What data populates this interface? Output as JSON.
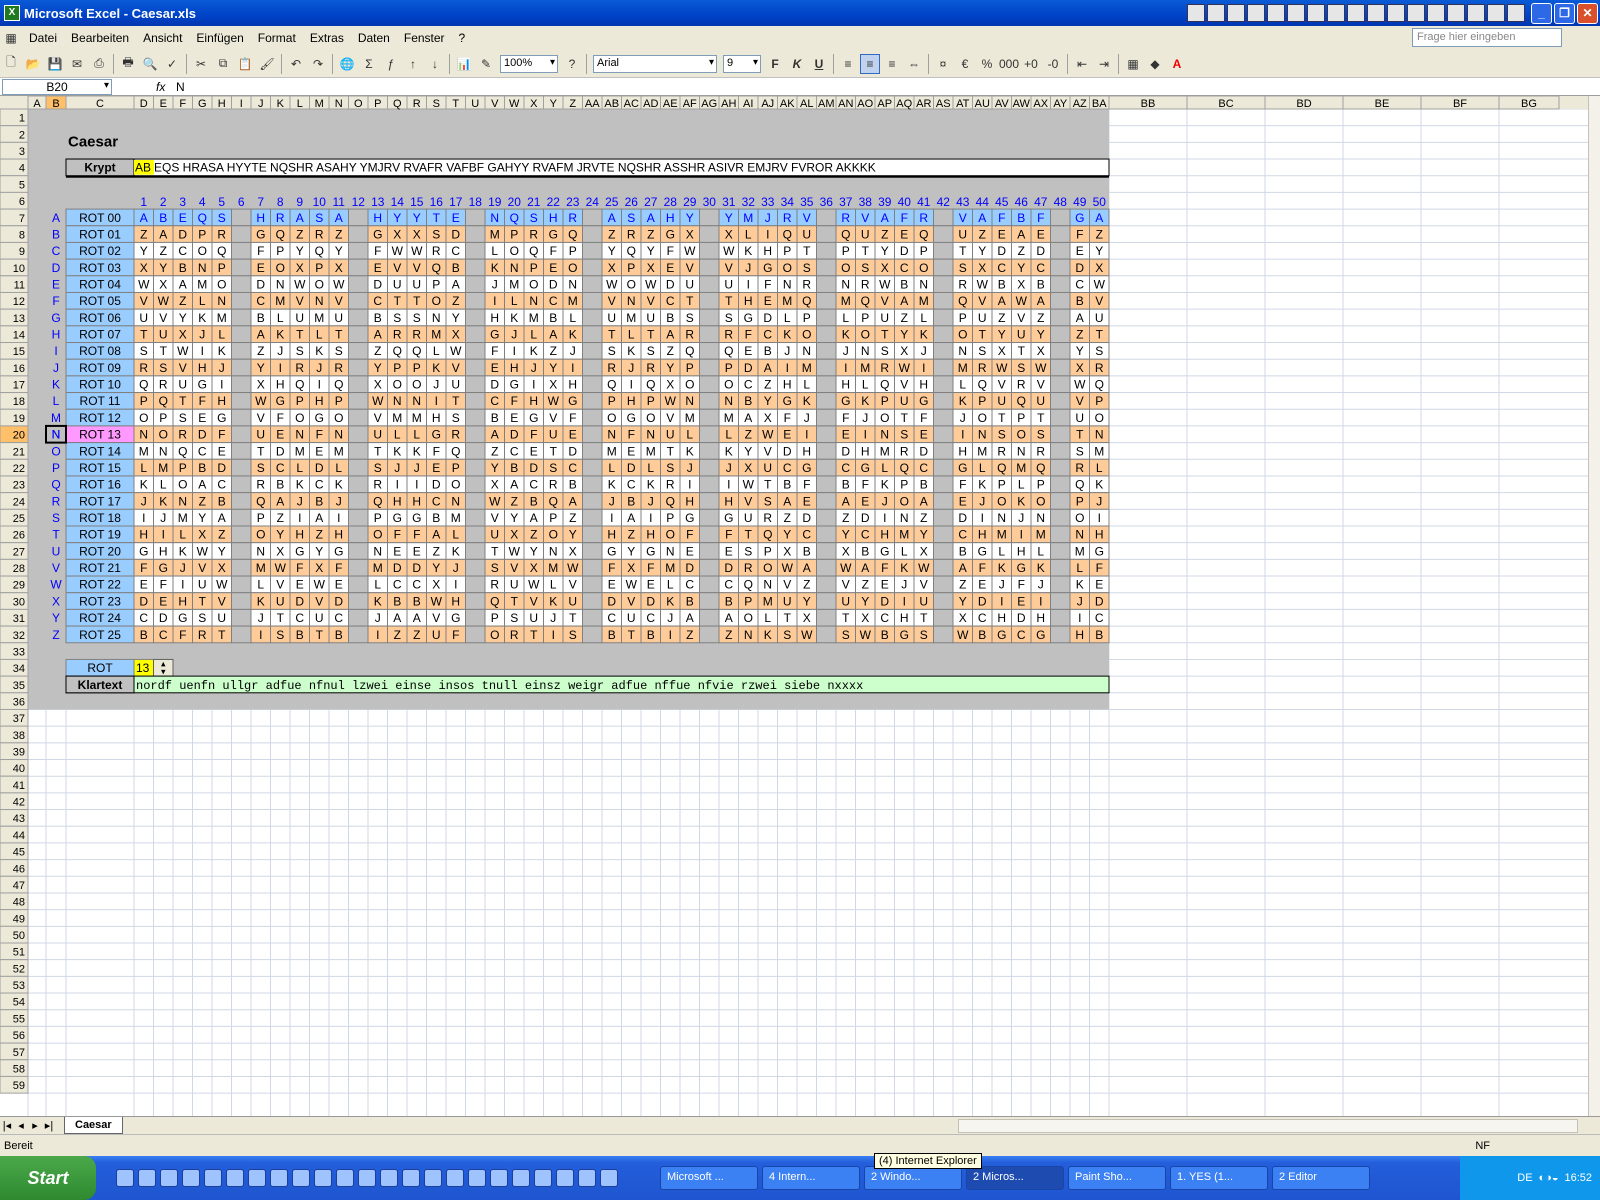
{
  "window": {
    "title": "Microsoft Excel - Caesar.xls"
  },
  "menu": {
    "items": [
      "Datei",
      "Bearbeiten",
      "Ansicht",
      "Einfügen",
      "Format",
      "Extras",
      "Daten",
      "Fenster",
      "?"
    ],
    "help_placeholder": "Frage hier eingeben"
  },
  "toolbar": {
    "zoom": "100%",
    "font": "Arial",
    "size": "9",
    "bold": "F",
    "italic": "K",
    "underline": "U"
  },
  "formula_bar": {
    "name_box": "B20",
    "fx": "fx",
    "formula": "N"
  },
  "columns": [
    "A",
    "B",
    "C",
    "D",
    "E",
    "F",
    "G",
    "H",
    "I",
    "J",
    "K",
    "L",
    "M",
    "N",
    "O",
    "P",
    "Q",
    "R",
    "S",
    "T",
    "U",
    "V",
    "W",
    "X",
    "Y",
    "Z",
    "AA",
    "AB",
    "AC",
    "AD",
    "AE",
    "AF",
    "AG",
    "AH",
    "AI",
    "AJ",
    "AK",
    "AL",
    "AM",
    "AN",
    "AO",
    "AP",
    "AQ",
    "AR",
    "AS",
    "AT",
    "AU",
    "AV",
    "AW",
    "AX",
    "AY",
    "AZ",
    "BA",
    "BB",
    "BC",
    "BD",
    "BE",
    "BF",
    "BG"
  ],
  "row_count": 59,
  "sheet": {
    "title": "Caesar",
    "krypt_label": "Krypt",
    "krypt_prefix": "AB",
    "krypt_text": "EQS HRASA HYYTE NQSHR ASAHY YMJRV RVAFR VAFBF GAHYY RVAFM JRVTE NQSHR ASSHR ASIVR EMJRV FVROR AKKKK",
    "krypt": "ABEQS HRASA HYYTE NQSHR ASAHY YMJRV RVAFR VAFBF GAHYY RVAFM JRVTE NQSHR ASSHR ASIVR EMJRV FVROR AKKKK",
    "rot_label": "ROT",
    "rot_value": "13",
    "klartext_label": "Klartext",
    "klartext": "nordf uenfn ullgr adfue nfnul lzwei einse insos tnull einsz weigr adfue nffue nfvie rzwei siebe nxxxx",
    "highlight_row_label": "ROT 13",
    "selected_letter": "N",
    "alphabet": "ABCDEFGHIJKLMNOPQRSTUVWXYZ"
  },
  "sheet_tab": "Caesar",
  "status": {
    "ready": "Bereit",
    "nf": "NF"
  },
  "tooltip": "(4) Internet Explorer",
  "taskbar": {
    "start": "Start",
    "tasks": [
      "Microsoft ...",
      "4 Intern...",
      "2 Windo...",
      "2 Micros...",
      "Paint Sho...",
      "1. YES (1...",
      "2 Editor"
    ],
    "lang": "DE",
    "clock": "16:52"
  },
  "colors": {
    "gray_bg": "#c0c0c0",
    "blue_label": "#99ccff",
    "orange": "#ffcc99",
    "white": "#ffffff",
    "yellow": "#ffff00",
    "green": "#ccffcc",
    "pink": "#ff99ff",
    "header": "#ece9d8",
    "blue_text": "#0000ff"
  }
}
